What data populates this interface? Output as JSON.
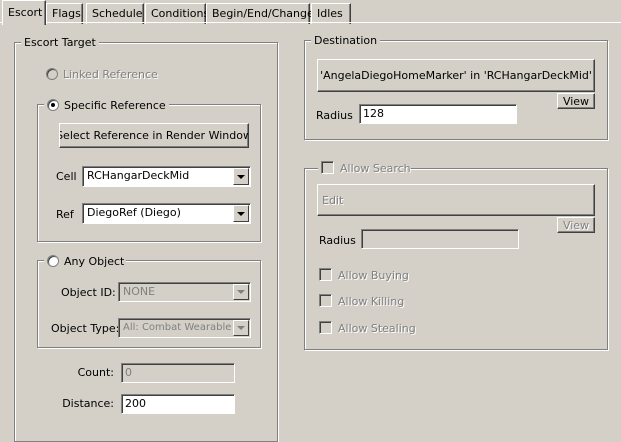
{
  "tabs": [
    "Escort",
    "Flags",
    "Schedule",
    "Conditions",
    "Begin/End/Change",
    "Idles"
  ],
  "escort_target": {
    "title": "Escort Target",
    "linked_reference": "Linked Reference",
    "specific_reference": {
      "title": "Specific Reference",
      "select_button": "Select Reference in Render Window",
      "cell_label": "Cell",
      "cell_value": "RCHangarDeckMid",
      "ref_label": "Ref",
      "ref_value": "DiegoRef (Diego)"
    },
    "any_object": {
      "title": "Any Object",
      "object_id_label": "Object ID:",
      "object_id_value": "NONE",
      "object_type_label": "Object Type:",
      "object_type_value": "All: Combat Wearable"
    },
    "count_label": "Count:",
    "count_value": "0",
    "distance_label": "Distance:",
    "distance_value": "200"
  },
  "destination": {
    "title": "Destination",
    "target_button": "'AngelaDiegoHomeMarker' in 'RCHangarDeckMid'",
    "view_button": "View",
    "radius_label": "Radius",
    "radius_value": "128"
  },
  "search": {
    "allow_search": "Allow Search",
    "edit_button": "Edit",
    "view_button": "View",
    "radius_label": "Radius",
    "radius_value": "",
    "allow_buying": "Allow Buying",
    "allow_killing": "Allow Killing",
    "allow_stealing": "Allow Stealing"
  },
  "colors": {
    "face": "#d4d0c8",
    "shadow": "#808080",
    "highlight": "#ffffff",
    "disabled_text": "#808080"
  }
}
